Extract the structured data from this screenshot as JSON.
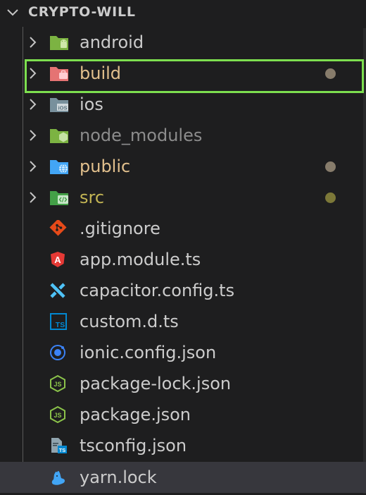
{
  "explorer": {
    "section_title": "CRYPTO-WILL"
  },
  "colors": {
    "text_default": "#cccccc",
    "text_modified": "#e2c08d",
    "text_untracked": "#c3b554",
    "text_ignored": "#8c8c8c",
    "dot_modified": "#877c6b",
    "dot_untracked": "#7c7838",
    "focus_border": "#7ddf4f",
    "selected_bg": "#37373d"
  },
  "tree": {
    "folders": [
      {
        "name": "android",
        "icon": "android-folder-icon"
      },
      {
        "name": "build",
        "icon": "build-folder-icon",
        "status": "modified"
      },
      {
        "name": "ios",
        "icon": "ios-folder-icon"
      },
      {
        "name": "node_modules",
        "icon": "node-folder-icon",
        "status": "ignored"
      },
      {
        "name": "public",
        "icon": "public-folder-icon",
        "status": "modified"
      },
      {
        "name": "src",
        "icon": "src-folder-icon",
        "status": "untracked"
      }
    ],
    "files": [
      {
        "name": ".gitignore",
        "icon": "git-icon"
      },
      {
        "name": "app.module.ts",
        "icon": "angular-icon"
      },
      {
        "name": "capacitor.config.ts",
        "icon": "capacitor-icon"
      },
      {
        "name": "custom.d.ts",
        "icon": "typescript-definition-icon"
      },
      {
        "name": "ionic.config.json",
        "icon": "ionic-icon"
      },
      {
        "name": "package-lock.json",
        "icon": "nodejs-icon"
      },
      {
        "name": "package.json",
        "icon": "nodejs-icon"
      },
      {
        "name": "tsconfig.json",
        "icon": "tsconfig-icon"
      },
      {
        "name": "yarn.lock",
        "icon": "yarn-icon",
        "selected": true
      }
    ]
  }
}
